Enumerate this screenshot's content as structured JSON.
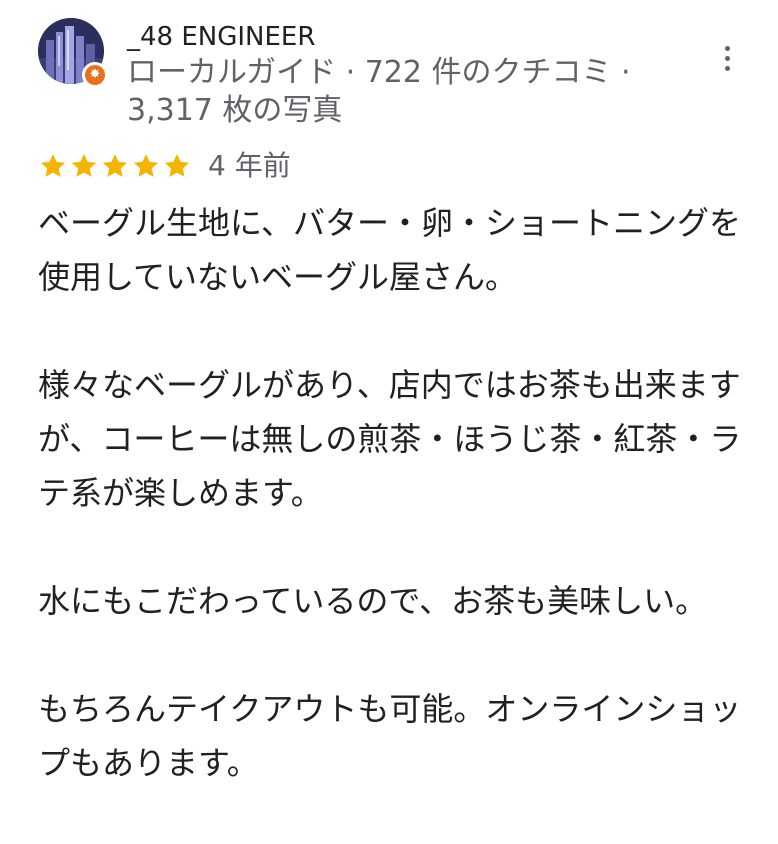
{
  "review": {
    "author": {
      "name": "_48 ENGINEER",
      "meta": "ローカルガイド · 722 件のクチコミ · 3,317 枚の写真",
      "avatar_icon": "avatar-city-image",
      "badge_icon": "local-guide-badge-icon"
    },
    "menu_icon": "more-vert-icon",
    "rating": {
      "stars": 5,
      "max": 5,
      "color": "#f4b400",
      "date": "4 年前"
    },
    "paragraphs": [
      "ベーグル生地に、バター・卵・ショートニングを使用していないベーグル屋さん。",
      "様々なベーグルがあり、店内ではお茶も出来ますが、コーヒーは無しの煎茶・ほうじ茶・紅茶・ラテ系が楽しめます。",
      "水にもこだわっているので、お茶も美味しい。",
      "もちろんテイクアウトも可能。オンラインショップもあります。"
    ]
  },
  "colors": {
    "text_primary": "#202124",
    "text_secondary": "#5f6368",
    "badge": "#e8711e",
    "star": "#f4b400"
  }
}
